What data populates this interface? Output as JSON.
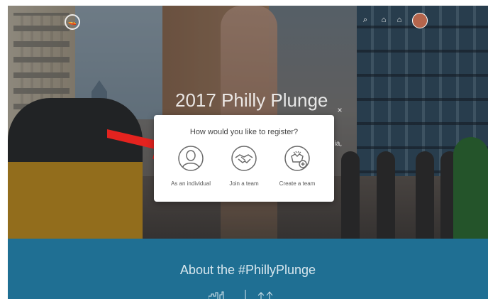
{
  "hero": {
    "title": "2017 Philly Plunge",
    "side_text": "hia,"
  },
  "nav": {
    "logo_glyph": "🚤",
    "icons": [
      "search-icon",
      "cart-icon",
      "person-icon"
    ],
    "icon_glyphs": [
      "⌕",
      "⌂",
      "⌂"
    ]
  },
  "modal": {
    "title": "How would you like to register?",
    "close_glyph": "×",
    "options": [
      {
        "label": "As an individual",
        "icon": "person-icon"
      },
      {
        "label": "Join a team",
        "icon": "handshake-icon"
      },
      {
        "label": "Create a team",
        "icon": "create-team-icon"
      }
    ]
  },
  "about": {
    "title": "About the #PhillyPlunge"
  },
  "colors": {
    "accent_blue": "#1f6f93",
    "arrow_red": "#e4231f",
    "icon_gray": "#6a6a6a"
  }
}
